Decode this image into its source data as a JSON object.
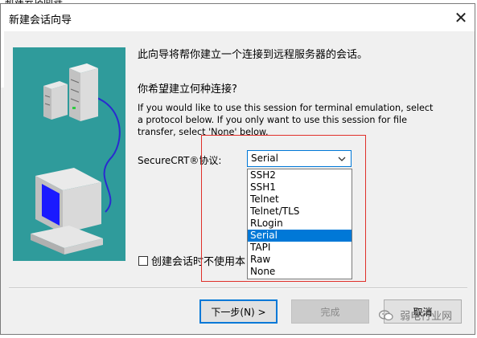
{
  "window": {
    "top_fragment": "新建会话向导",
    "title": "新建会话向导",
    "close_glyph": "✕"
  },
  "content": {
    "intro": "此向导将帮你建立一个连接到远程服务器的会话。",
    "question": "你希望建立何种连接?",
    "description": "If you would like to use this session for terminal emulation, select a protocol below. If you only want to use this session for file transfer, select 'None' below.",
    "protocol_label": "SecureCRT®协议:",
    "protocol_selected": "Serial",
    "protocol_options": [
      "SSH2",
      "SSH1",
      "Telnet",
      "Telnet/TLS",
      "RLogin",
      "Serial",
      "TAPI",
      "Raw",
      "None"
    ],
    "checkbox_label": "创建会话时不使用本"
  },
  "buttons": {
    "next": "下一步(N) >",
    "finish": "完成",
    "cancel": "取消"
  },
  "watermark": "弱电行业网",
  "colors": {
    "illustration_bg": "#2f9b9b",
    "selection": "#0078d7",
    "highlight_box": "#e0302a"
  },
  "icons": [
    "server-icon",
    "computer-icon",
    "close-icon",
    "chevron-down-icon",
    "wechat-icon"
  ]
}
